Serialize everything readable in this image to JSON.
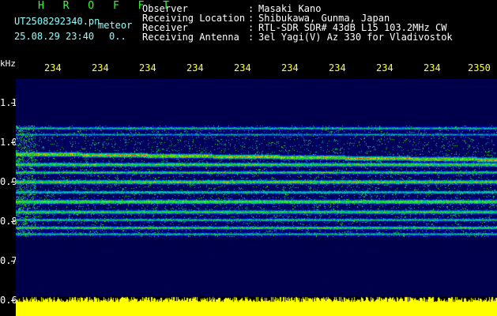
{
  "header": {
    "brand": "H R O F F T",
    "filename": "UT2508292340.pn",
    "mode": "meteor",
    "datetime": "25.08.29 23:40",
    "count": "0..",
    "fields": [
      {
        "label": "Observer",
        "sep": ":",
        "value": "Masaki Kano"
      },
      {
        "label": "Receiving Location",
        "sep": ":",
        "value": "Shibukawa, Gunma, Japan"
      },
      {
        "label": "Receiver",
        "sep": ":",
        "value": "RTL-SDR SDR# 43dB L15 103.2MHz CW"
      },
      {
        "label": "Receiving Antenna",
        "sep": ":",
        "value": "3el Yagi(V) Az 330 for Vladivostok"
      }
    ]
  },
  "axis": {
    "unit": "kHz",
    "freq_labels": [
      "1.1",
      "1.0",
      "0.9",
      "0.8",
      "0.7",
      "0.6"
    ],
    "time_labels": [
      "234",
      "234",
      "234",
      "234",
      "234",
      "234",
      "234",
      "234",
      "234",
      "2350"
    ]
  },
  "colors": {
    "background": "#000000",
    "header_text": "#ffffff",
    "brand": "#33ff33",
    "info": "#8cffff",
    "time_labels": "#ffff33",
    "amplitude": "#ffff00"
  }
}
